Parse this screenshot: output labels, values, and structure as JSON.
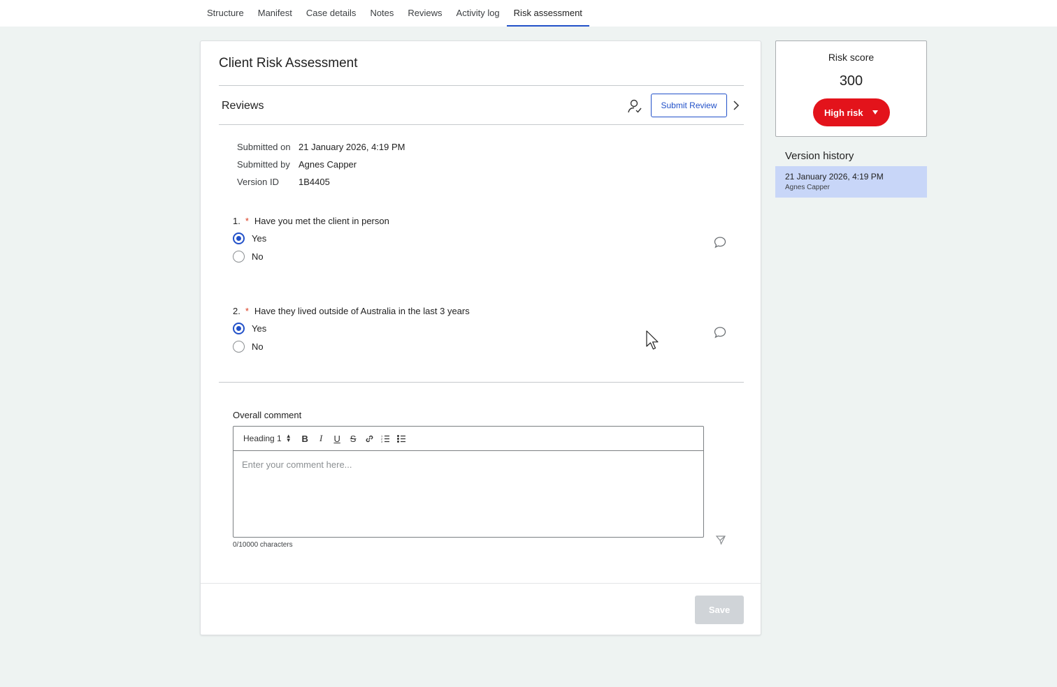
{
  "tabs": [
    {
      "label": "Structure"
    },
    {
      "label": "Manifest"
    },
    {
      "label": "Case details"
    },
    {
      "label": "Notes"
    },
    {
      "label": "Reviews"
    },
    {
      "label": "Activity log"
    },
    {
      "label": "Risk assessment",
      "active": true
    }
  ],
  "card": {
    "title": "Client Risk Assessment",
    "reviews": {
      "title": "Reviews",
      "submit_label": "Submit Review",
      "user_icon": "user-check-icon",
      "next_icon": "chevron-right-icon"
    },
    "meta": {
      "submitted_on_label": "Submitted on",
      "submitted_on": "21 January 2026, 4:19 PM",
      "submitted_by_label": "Submitted by",
      "submitted_by": "Agnes Capper",
      "version_label": "Version ID",
      "version_id": "1B4405"
    },
    "questions": [
      {
        "number": "1.",
        "required": "*",
        "text": "Have you met the client in person",
        "options": [
          "Yes",
          "No"
        ],
        "selected": "Yes"
      },
      {
        "number": "2.",
        "required": "*",
        "text": "Have they lived outside of Australia in the last 3 years",
        "options": [
          "Yes",
          "No"
        ],
        "selected": "Yes"
      }
    ],
    "overall_comment": {
      "label": "Overall comment",
      "heading_select": "Heading 1",
      "placeholder": "Enter your comment here...",
      "char_count": "0/10000 characters"
    },
    "save_label": "Save"
  },
  "risk": {
    "label": "Risk score",
    "score": "300",
    "level": "High risk",
    "level_color": "#e3131b"
  },
  "version_history": {
    "title": "Version history",
    "items": [
      {
        "date": "21 January 2026, 4:19 PM",
        "user": "Agnes Capper",
        "selected": true
      }
    ]
  },
  "colors": {
    "accent": "#2251c9",
    "background": "#eef3f2",
    "selected_version": "#c8d6f8"
  }
}
